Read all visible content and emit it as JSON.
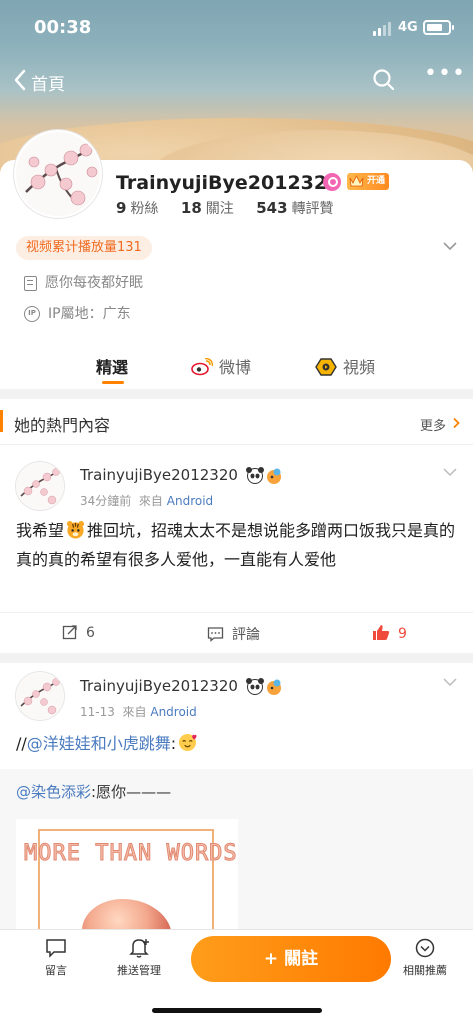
{
  "status": {
    "time": "00:38",
    "network": "4G"
  },
  "nav": {
    "back_label": "首頁"
  },
  "profile": {
    "username": "TrainyujiBye2012320",
    "vip_label": "开通",
    "stats": [
      {
        "value": "9",
        "label": "粉絲"
      },
      {
        "value": "18",
        "label": "關注"
      },
      {
        "value": "543",
        "label": "轉評贊"
      }
    ],
    "play_tag": "视频累计播放量131",
    "bio": "愿你每夜都好眠",
    "ip_location": "IP屬地：广东",
    "ip_icon_text": "IP"
  },
  "tabs": [
    {
      "label": "精選",
      "active": true
    },
    {
      "label": "微博",
      "icon": "weibo-icon"
    },
    {
      "label": "視頻",
      "icon": "video-icon"
    }
  ],
  "hot": {
    "title": "她的熱門內容",
    "more_label": "更多"
  },
  "posts": [
    {
      "author": "TrainyujiBye2012320",
      "time": "34分鐘前",
      "source_prefix": "來自",
      "source": "Android",
      "text_a": "我希望",
      "text_b": "推回坑，招魂太太不是想说能多蹭两口饭我只是真的真的真的希望有很多人爱他，一直能有人爱他",
      "reposts": "6",
      "comments_label": "評論",
      "likes": "9"
    },
    {
      "author": "TrainyujiBye2012320",
      "time": "11-13",
      "source_prefix": "來自",
      "source": "Android",
      "text_prefix": "//",
      "mention": "@洋娃娃和小虎跳舞",
      "text_suffix": ":",
      "repost_mention": "@染色添彩",
      "repost_text": ":愿你———",
      "repost_image_text": "MORE THAN WORDS"
    }
  ],
  "bottom": {
    "comment_label": "留言",
    "push_label": "推送管理",
    "follow_label": "+ 關註",
    "related_label": "相關推薦"
  },
  "colors": {
    "accent": "#ff8200",
    "link": "#4b7bbf",
    "like": "#f04a3a"
  }
}
